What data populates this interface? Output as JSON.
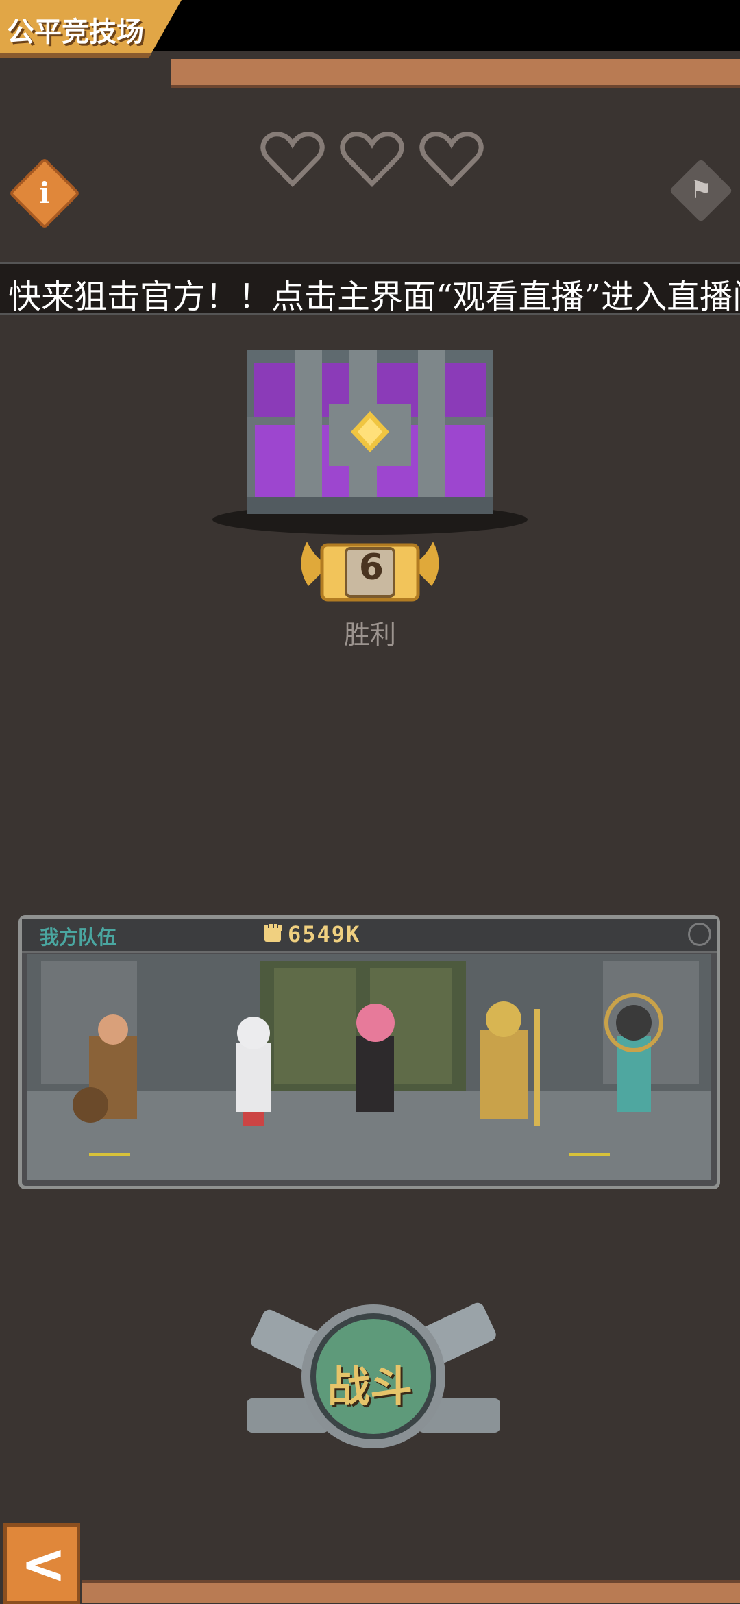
{
  "header": {
    "title": "公平竞技场"
  },
  "lives": {
    "total": 3,
    "remaining": 3
  },
  "icons": {
    "info": "info-icon",
    "flag": "flag-icon",
    "back": "back-arrow-icon",
    "power": "fist-icon"
  },
  "ticker": {
    "text": "快来狙击官方！！点击主界面“观看直播”进入直播间！！"
  },
  "reward": {
    "wins": "6",
    "label": "胜利"
  },
  "team": {
    "label": "我方队伍",
    "power": "6549K"
  },
  "actions": {
    "battle_label": "战斗"
  },
  "colors": {
    "accent": "#e0873a",
    "gold": "#e1a646",
    "team_label": "#4aa6a0",
    "background": "#3a3431"
  }
}
